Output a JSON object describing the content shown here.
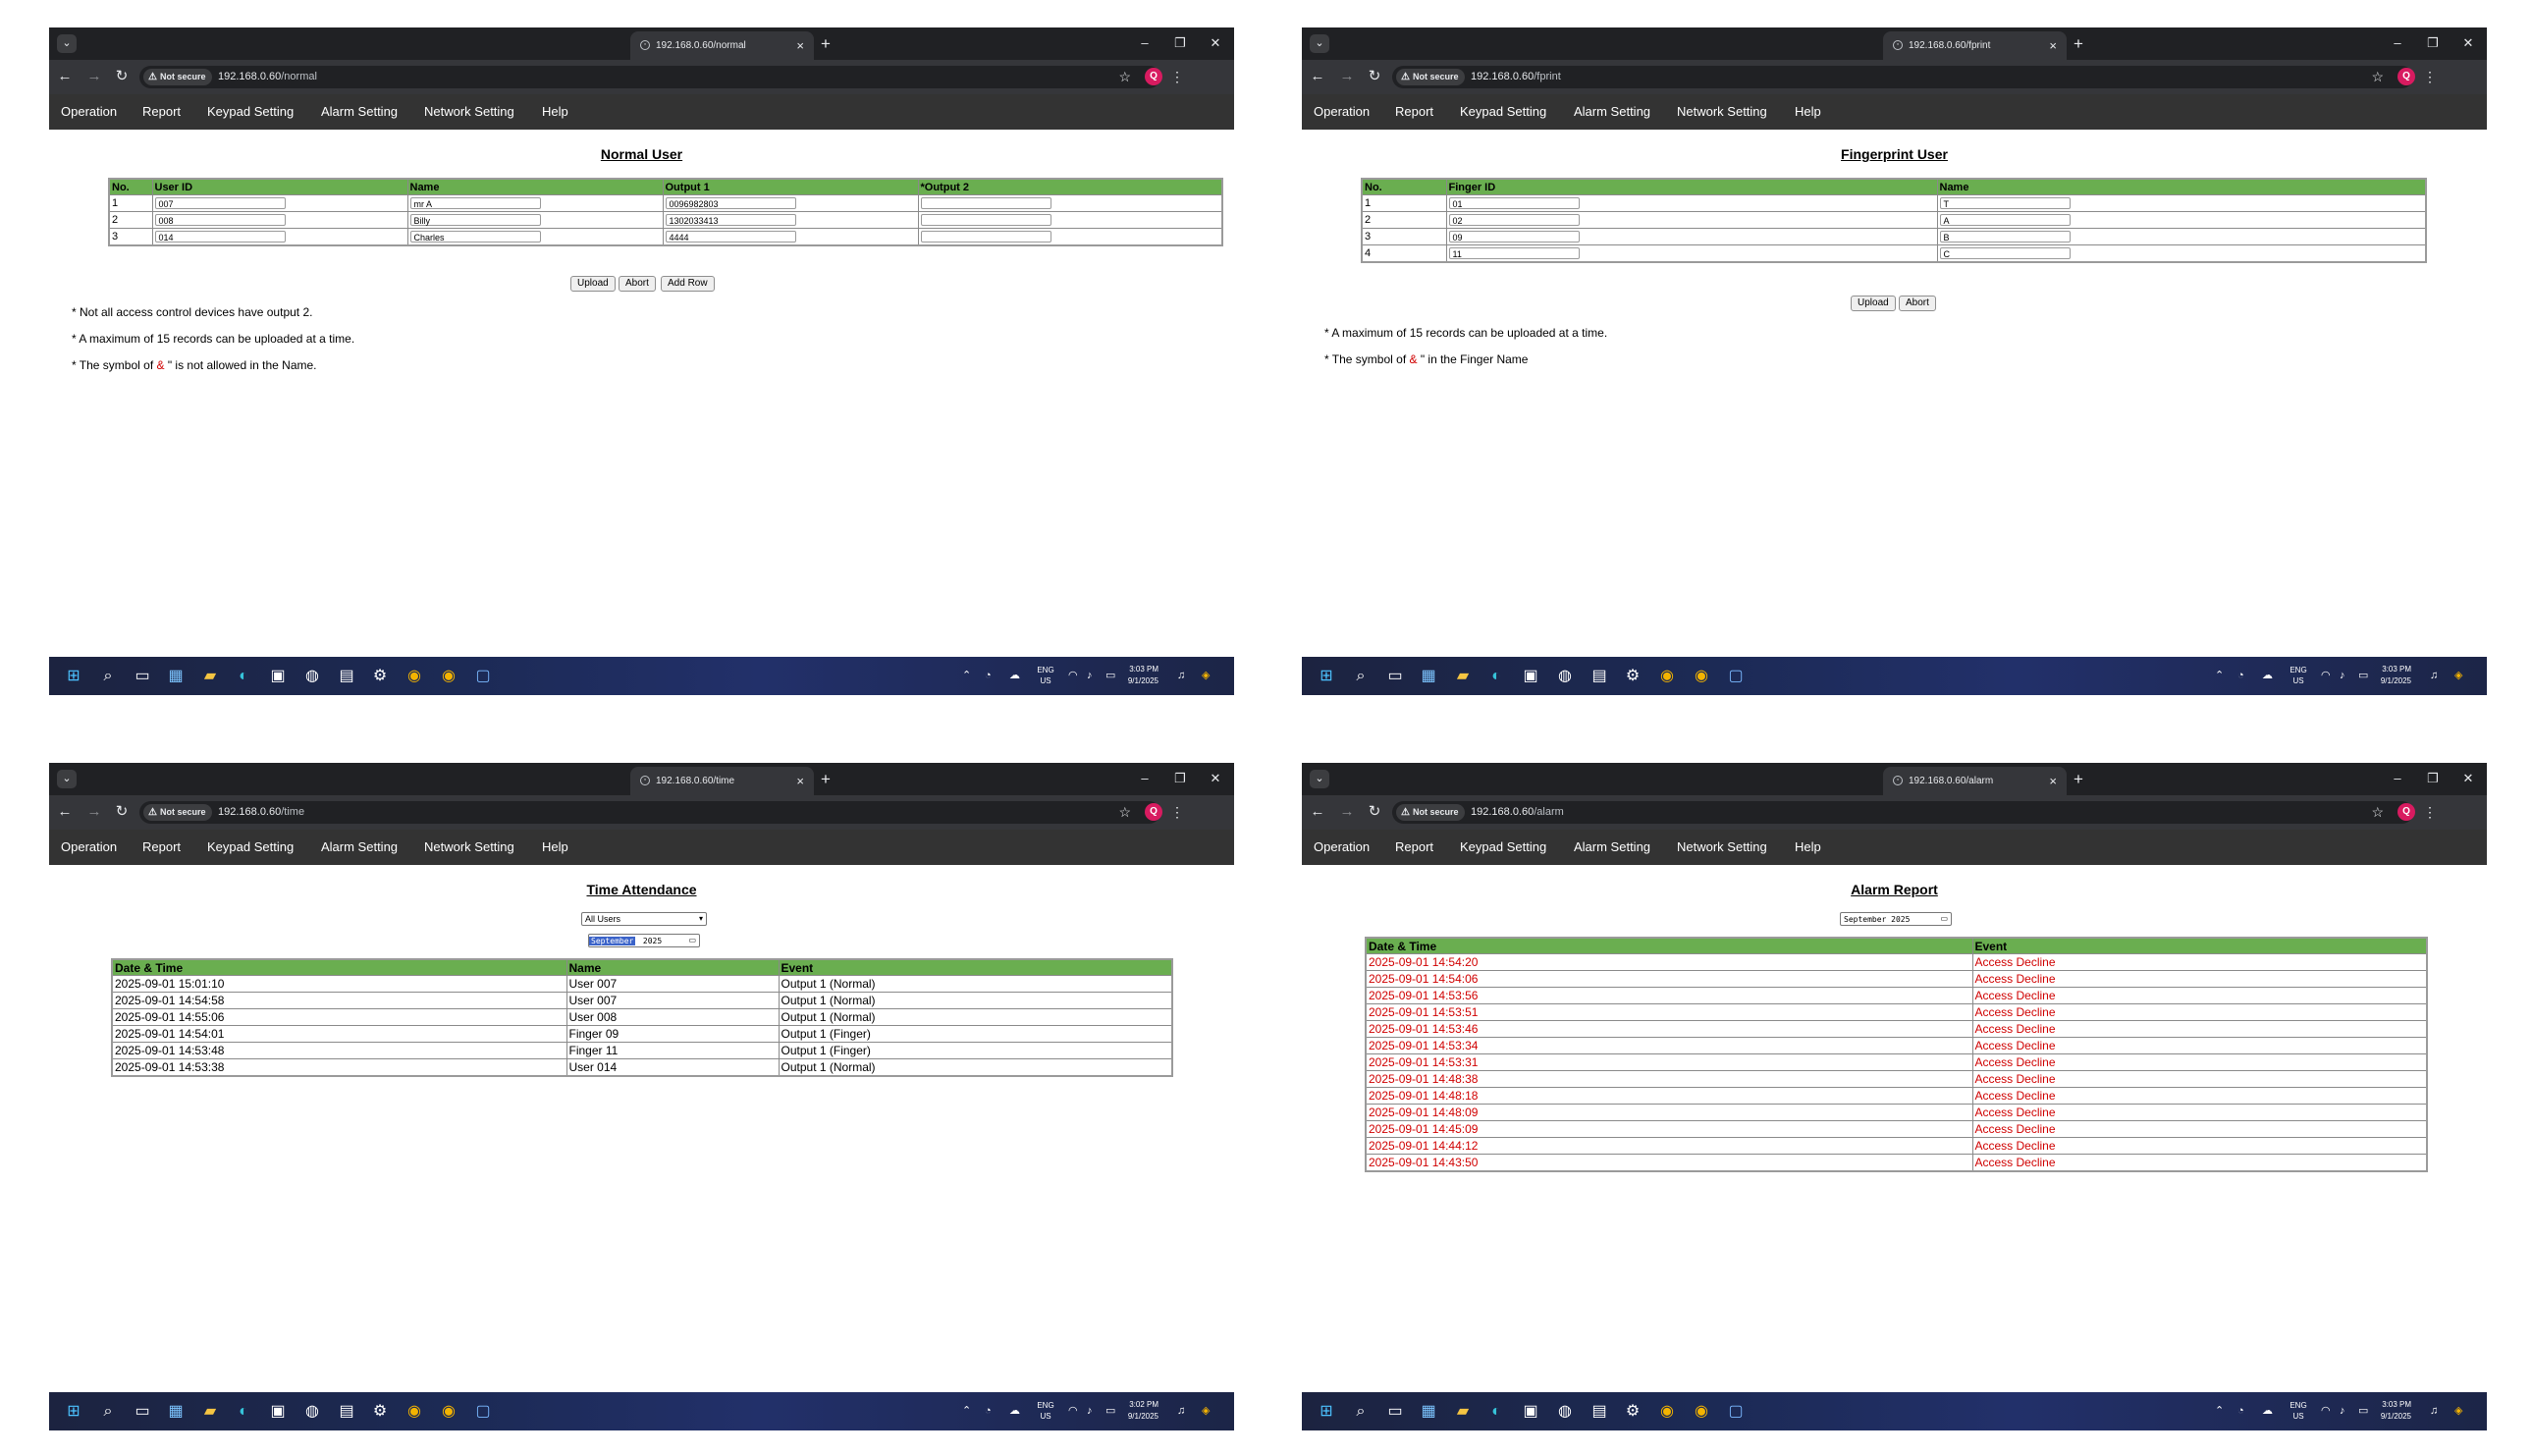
{
  "common": {
    "not_secure": "Not secure",
    "url_host": "192.168.0.60",
    "menu": [
      "Operation",
      "Report",
      "Keypad Setting",
      "Alarm Setting",
      "Network Setting",
      "Help"
    ],
    "tray": {
      "lang": "ENG",
      "region": "US",
      "date": "9/1/2025"
    }
  },
  "panel_normal": {
    "tab_title": "192.168.0.60/normal",
    "url_path": "/normal",
    "page_title": "Normal User",
    "columns": [
      "No.",
      "User ID",
      "Name",
      "Output 1",
      "*Output 2"
    ],
    "rows": [
      {
        "no": "1",
        "user_id": "007",
        "name": "mr A",
        "output1": "0096982803",
        "output2": ""
      },
      {
        "no": "2",
        "user_id": "008",
        "name": "Billy",
        "output1": "1302033413",
        "output2": ""
      },
      {
        "no": "3",
        "user_id": "014",
        "name": "Charles",
        "output1": "4444",
        "output2": ""
      }
    ],
    "buttons": {
      "upload": "Upload",
      "abort": "Abort",
      "add_row": "Add Row"
    },
    "notes": {
      "n1": "* Not all access control devices have output 2.",
      "n2": "* A maximum of 15 records can be uploaded at a time.",
      "n3_pre": "* The symbol of ",
      "n3_sym": "&",
      "n3_post": " \" is not allowed in the Name."
    },
    "clock": "3:03 PM"
  },
  "panel_fprint": {
    "tab_title": "192.168.0.60/fprint",
    "url_path": "/fprint",
    "page_title": "Fingerprint User",
    "columns": [
      "No.",
      "Finger ID",
      "Name"
    ],
    "rows": [
      {
        "no": "1",
        "finger_id": "01",
        "name": "T"
      },
      {
        "no": "2",
        "finger_id": "02",
        "name": "A"
      },
      {
        "no": "3",
        "finger_id": "09",
        "name": "B"
      },
      {
        "no": "4",
        "finger_id": "11",
        "name": "C"
      }
    ],
    "buttons": {
      "upload": "Upload",
      "abort": "Abort"
    },
    "notes": {
      "n1": "* A maximum of 15 records can be uploaded at a time.",
      "n2_pre": "* The symbol of ",
      "n2_sym": "&",
      "n2_post": " \" in the Finger Name"
    },
    "clock": "3:03 PM"
  },
  "panel_time": {
    "tab_title": "192.168.0.60/time",
    "url_path": "/time",
    "page_title": "Time Attendance",
    "user_filter": "All Users",
    "month_selected": "September",
    "year": "2025",
    "columns": [
      "Date & Time",
      "Name",
      "Event"
    ],
    "rows": [
      {
        "datetime": "2025-09-01 15:01:10",
        "name": "User 007",
        "event": "Output 1 (Normal)"
      },
      {
        "datetime": "2025-09-01 14:54:58",
        "name": "User 007",
        "event": "Output 1 (Normal)"
      },
      {
        "datetime": "2025-09-01 14:55:06",
        "name": "User 008",
        "event": "Output 1 (Normal)"
      },
      {
        "datetime": "2025-09-01 14:54:01",
        "name": "Finger 09",
        "event": "Output 1 (Finger)"
      },
      {
        "datetime": "2025-09-01 14:53:48",
        "name": "Finger 11",
        "event": "Output 1 (Finger)"
      },
      {
        "datetime": "2025-09-01 14:53:38",
        "name": "User 014",
        "event": "Output 1 (Normal)"
      }
    ],
    "clock": "3:02 PM"
  },
  "panel_alarm": {
    "tab_title": "192.168.0.60/alarm",
    "url_path": "/alarm",
    "page_title": "Alarm Report",
    "month_value": "September 2025",
    "columns": [
      "Date & Time",
      "Event"
    ],
    "rows": [
      {
        "datetime": "2025-09-01 14:54:20",
        "event": "Access Decline"
      },
      {
        "datetime": "2025-09-01 14:54:06",
        "event": "Access Decline"
      },
      {
        "datetime": "2025-09-01 14:53:56",
        "event": "Access Decline"
      },
      {
        "datetime": "2025-09-01 14:53:51",
        "event": "Access Decline"
      },
      {
        "datetime": "2025-09-01 14:53:46",
        "event": "Access Decline"
      },
      {
        "datetime": "2025-09-01 14:53:34",
        "event": "Access Decline"
      },
      {
        "datetime": "2025-09-01 14:53:31",
        "event": "Access Decline"
      },
      {
        "datetime": "2025-09-01 14:48:38",
        "event": "Access Decline"
      },
      {
        "datetime": "2025-09-01 14:48:18",
        "event": "Access Decline"
      },
      {
        "datetime": "2025-09-01 14:48:09",
        "event": "Access Decline"
      },
      {
        "datetime": "2025-09-01 14:45:09",
        "event": "Access Decline"
      },
      {
        "datetime": "2025-09-01 14:44:12",
        "event": "Access Decline"
      },
      {
        "datetime": "2025-09-01 14:43:50",
        "event": "Access Decline"
      }
    ],
    "clock": "3:03 PM"
  }
}
